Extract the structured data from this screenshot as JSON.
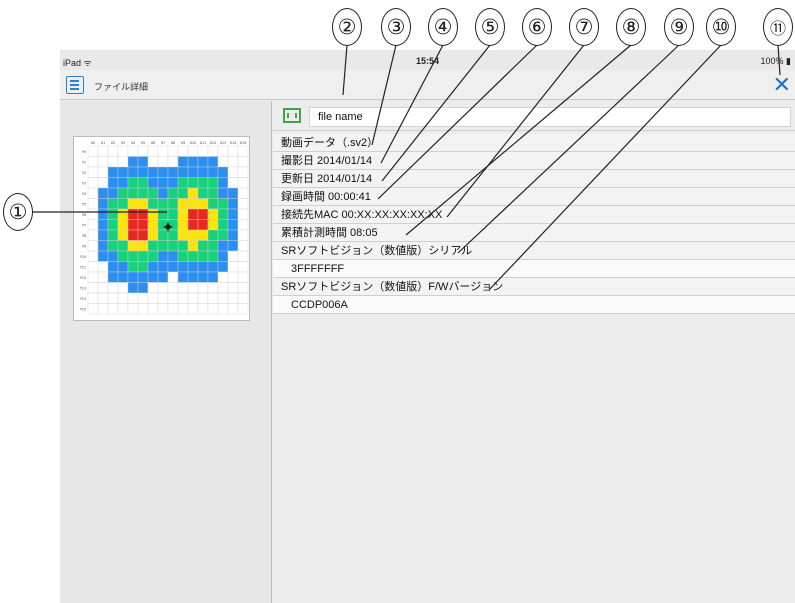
{
  "callouts": [
    "①",
    "②",
    "③",
    "④",
    "⑤",
    "⑥",
    "⑦",
    "⑧",
    "⑨",
    "⑩",
    "⑪"
  ],
  "status": {
    "carrier": "iPad ᯤ",
    "time": "15:54",
    "battery": "100% ▮"
  },
  "nav": {
    "title": "ファイル詳細",
    "close_label": "✕",
    "menu_icon": "hamburger-icon"
  },
  "file": {
    "icon": "film-icon",
    "name": "file name"
  },
  "details": [
    "動画データ（.sv2）",
    "撮影日 2014/01/14",
    "更新日 2014/01/14",
    "録画時間 00:00:41",
    "接続先MAC 00:XX:XX:XX:XX:XX",
    "累積計測時間 08:05",
    "SRソフトビジョン（数値版）シリアル",
    "3FFFFFFF",
    "SRソフトビジョン（数値版）F/Wバージョン",
    "CCDP006A"
  ],
  "heatmap": {
    "col_labels": [
      "X0",
      "X1",
      "X2",
      "X3",
      "X4",
      "X5",
      "X6",
      "X7",
      "X8",
      "X9",
      "X10",
      "X11",
      "X12",
      "X13",
      "X14",
      "X15"
    ],
    "row_labels": [
      "Y0",
      "Y1",
      "Y2",
      "Y3",
      "Y4",
      "Y5",
      "Y6",
      "Y7",
      "Y8",
      "Y9",
      "Y10",
      "Y11",
      "Y12",
      "Y13",
      "Y14",
      "Y15"
    ],
    "colors": {
      "low": "#2a8ff0",
      "mid": "#16d27a",
      "high": "#ffe40a",
      "peak": "#e8281e"
    }
  }
}
